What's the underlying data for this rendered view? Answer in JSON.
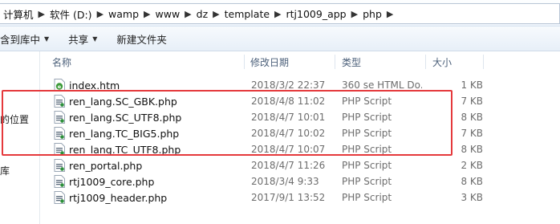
{
  "breadcrumb": [
    "计算机",
    "软件 (D:)",
    "wamp",
    "www",
    "dz",
    "template",
    "rtj1009_app",
    "php"
  ],
  "toolbar": {
    "include_in_library": "含到库中",
    "share": "共享",
    "new_folder": "新建文件夹"
  },
  "nav": {
    "location": "的位置",
    "misc": "库"
  },
  "columns": {
    "name": "名称",
    "date": "修改日期",
    "type": "类型",
    "size": "大小"
  },
  "files": [
    {
      "name": "index.htm",
      "date": "2018/3/2 22:37",
      "type": "360 se HTML Do...",
      "size": "1 KB",
      "icon": "html-file-icon"
    },
    {
      "name": "ren_lang.SC_GBK.php",
      "date": "2018/4/8 11:02",
      "type": "PHP Script",
      "size": "7 KB",
      "icon": "php-file-icon"
    },
    {
      "name": "ren_lang.SC_UTF8.php",
      "date": "2018/4/7 10:01",
      "type": "PHP Script",
      "size": "8 KB",
      "icon": "php-file-icon"
    },
    {
      "name": "ren_lang.TC_BIG5.php",
      "date": "2018/4/7 10:02",
      "type": "PHP Script",
      "size": "7 KB",
      "icon": "php-file-icon"
    },
    {
      "name": "ren_lang.TC_UTF8.php",
      "date": "2018/4/7 10:07",
      "type": "PHP Script",
      "size": "8 KB",
      "icon": "php-file-icon"
    },
    {
      "name": "ren_portal.php",
      "date": "2018/4/7 11:26",
      "type": "PHP Script",
      "size": "2 KB",
      "icon": "php-file-icon"
    },
    {
      "name": "rtj1009_core.php",
      "date": "2018/3/4 9:33",
      "type": "PHP Script",
      "size": "8 KB",
      "icon": "php-file-icon"
    },
    {
      "name": "rtj1009_header.php",
      "date": "2017/9/1 13:52",
      "type": "PHP Script",
      "size": "3 KB",
      "icon": "php-file-icon"
    }
  ],
  "colors": {
    "highlight_border": "#e5393c",
    "header_text": "#4c607a",
    "meta_text": "#6d6d6d"
  }
}
